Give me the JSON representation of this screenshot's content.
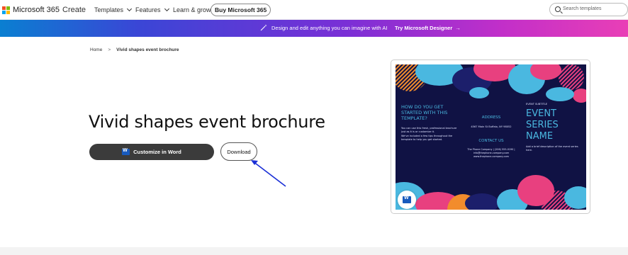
{
  "header": {
    "brand": "Microsoft 365",
    "create": "Create",
    "nav": [
      "Templates",
      "Features",
      "Learn & grow"
    ],
    "buy_label": "Buy Microsoft 365",
    "search_placeholder": "Search templates"
  },
  "banner": {
    "text": "Design and edit anything you can imagine with AI",
    "link": "Try Microsoft Designer"
  },
  "breadcrumb": {
    "home": "Home",
    "current": "Vivid shapes event brochure"
  },
  "page": {
    "title": "Vivid shapes event brochure",
    "primary_button": "Customize in Word",
    "download_button": "Download"
  },
  "brochure": {
    "question": "HOW DO YOU GET STARTED WITH THIS TEMPLATE?",
    "intro_1": "You can use this fresh, professional brochure just as it is or customize it.",
    "intro_2": "We've included a few tips throughout the template to help you get started.",
    "address_heading": "ADDRESS",
    "address": "4567 Main St Buffalo, NY 98052",
    "contact_heading": "CONTACT US",
    "contact_line_1": "The Phone Company | (206) 555-0190 |",
    "contact_line_2": "info@thephone-company.com",
    "contact_line_3": "www.thephone-company.com",
    "subtitle": "EVENT SUBTITLE",
    "event_name_1": "EVENT",
    "event_name_2": "SERIES",
    "event_name_3": "NAME",
    "description": "Add a brief description of the event series here."
  },
  "colors": {
    "banner_start": "#0a7fd1",
    "banner_end": "#e93fb6",
    "brochure_bg": "#101244",
    "accent_cyan": "#4ab8e0",
    "accent_pink": "#e8407f",
    "accent_orange": "#f28c2c",
    "annotation_arrow": "#1a2fd6"
  }
}
